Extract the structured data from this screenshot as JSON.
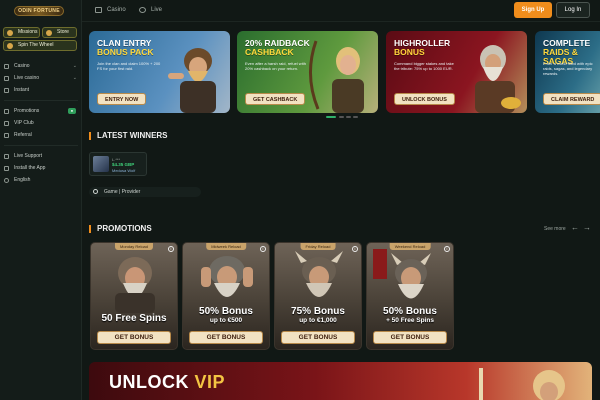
{
  "brand": {
    "logo_text": "ODIN FORTUNE"
  },
  "sidebar": {
    "missions": "Missions",
    "store": "Store",
    "spin_wheel": "Spin The Wheel",
    "items_top": [
      {
        "label": "Casino"
      },
      {
        "label": "Live casino"
      },
      {
        "label": "Instant"
      }
    ],
    "items_mid": [
      {
        "label": "Promotions",
        "badge": "●"
      },
      {
        "label": "VIP Club"
      },
      {
        "label": "Referral"
      }
    ],
    "items_bottom": [
      {
        "label": "Live Support"
      },
      {
        "label": "Install the App"
      },
      {
        "label": "English"
      }
    ]
  },
  "topbar": {
    "tabs": [
      {
        "label": "Casino"
      },
      {
        "label": "Live"
      }
    ],
    "signup": "Sign Up",
    "login": "Log In"
  },
  "banners": [
    {
      "title": "CLAN ENTRY",
      "subtitle": "BONUS PACK",
      "text": "Join the clan and claim 100% + 200 FS for your first raid.",
      "button": "ENTRY NOW"
    },
    {
      "title": "20% RAIDBACK",
      "subtitle": "CASHBACK",
      "text": "Even after a harsh raid, refuel with 20% cashback on your return.",
      "button": "GET CASHBACK"
    },
    {
      "title": "HIGHROLLER",
      "subtitle": "BONUS",
      "text": "Command bigger stakes and take the tribute: 75% up to 1000 EUR.",
      "button": "UNLOCK BONUS"
    },
    {
      "title": "COMPLETE",
      "subtitle": "RAIDS & SAGAS",
      "text": "Enter a world filled with epic raids, sagas, and legendary rewards.",
      "button": "CLAIM REWARD"
    }
  ],
  "latest_winners": {
    "title": "LATEST WINNERS",
    "winner": {
      "user": "L.***",
      "amount": "$4.35 GBP",
      "game": "Medusa Wolf"
    }
  },
  "search": {
    "placeholder": "Game | Provider"
  },
  "promotions": {
    "title": "PROMOTIONS",
    "see_more": "See more",
    "prev": "←",
    "next": "→",
    "cards": [
      {
        "tag": "Monday Reload",
        "line1": "50 Free Spins",
        "line2": "",
        "button": "GET BONUS"
      },
      {
        "tag": "Midweek Reload",
        "line1": "50% Bonus",
        "line2": "up to €500",
        "button": "GET BONUS"
      },
      {
        "tag": "Friday Reload",
        "line1": "75% Bonus",
        "line2": "up to €1,000",
        "button": "GET BONUS"
      },
      {
        "tag": "Weekend Reload",
        "line1": "50% Bonus",
        "line2": "+ 50 Free Spins",
        "button": "GET BONUS"
      }
    ]
  },
  "vip": {
    "title_a": "UNLOCK",
    "title_b": "VIP"
  },
  "colors": {
    "accent": "#f08d1c",
    "background": "#111815",
    "sidebar": "#141c19"
  }
}
